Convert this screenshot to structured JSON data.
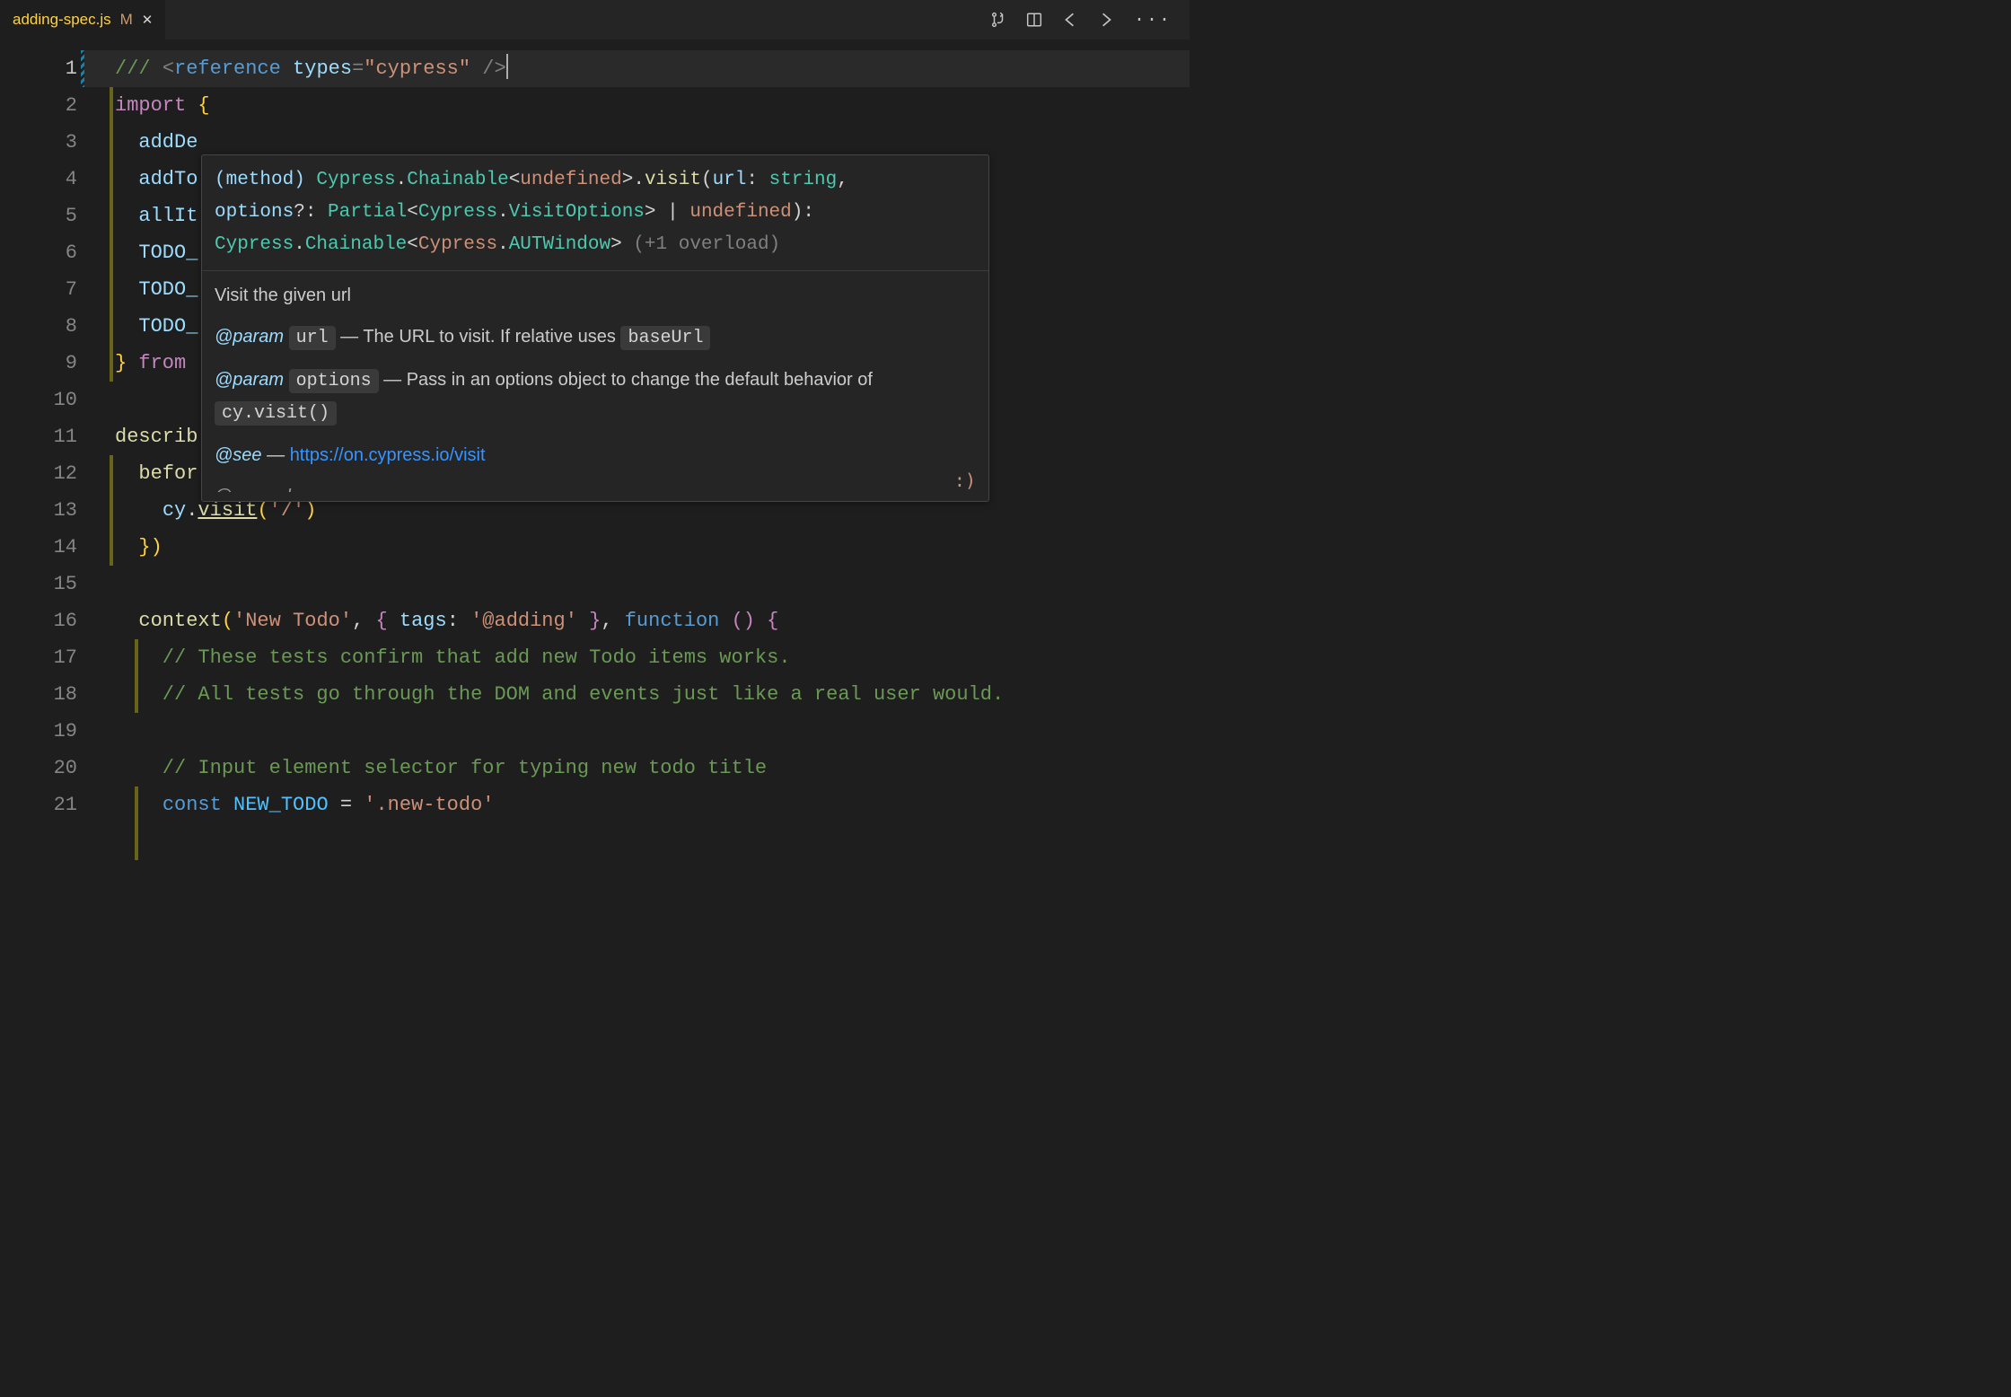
{
  "tab": {
    "filename": "adding-spec.js",
    "modified_marker": "M"
  },
  "line_numbers": [
    "1",
    "2",
    "3",
    "4",
    "5",
    "6",
    "7",
    "8",
    "9",
    "10",
    "11",
    "12",
    "13",
    "14",
    "15",
    "16",
    "17",
    "18",
    "19",
    "20",
    "21"
  ],
  "code": {
    "l1_ref": "/// <reference types=\"cypress\" />",
    "l2": "import {",
    "l3": "  addDe",
    "l4": "  addTo",
    "l5": "  allIt",
    "l6": "  TODO_",
    "l7": "  TODO_",
    "l8": "  TODO_",
    "l9": "} from ",
    "l11": "describ",
    "l12": "  befor",
    "l13_cy": "    cy.",
    "l13_visit": "visit",
    "l13_arg": "('/')",
    "l14": "  })",
    "l16_context": "  context(",
    "l16_str1": "'New Todo'",
    "l16_mid": ", { ",
    "l16_tags": "tags",
    "l16_colon": ": ",
    "l16_str2": "'@adding'",
    "l16_end": " }, ",
    "l16_func": "function",
    "l16_paren": " () {",
    "l17": "    // These tests confirm that add new Todo items works.",
    "l18": "    // All tests go through the DOM and events just like a real user would.",
    "l20": "    // Input element selector for typing new todo title",
    "l21_const": "    const ",
    "l21_name": "NEW_TODO",
    "l21_eq": " = ",
    "l21_val": "'.new-todo'"
  },
  "hover": {
    "sig_method": "(method)",
    "sig_cypress": " Cypress",
    "sig_dot": ".",
    "sig_chainable": "Chainable",
    "sig_lt": "<",
    "sig_undef": "undefined",
    "sig_gt_visit": ">.visit(",
    "sig_url": "url",
    "sig_colon_string": ": string, ",
    "sig_options": "options",
    "sig_opt_type": "?: Partial<Cypress.VisitOptions> | undefined): Cypress.Chainable<Cypress.AUTWindow>",
    "sig_overload": " (+1 overload)",
    "doc_visit": "Visit the given url",
    "doc_param": "@param",
    "doc_url_code": "url",
    "doc_url_desc": " — The URL to visit. If relative uses ",
    "doc_baseurl": "baseUrl",
    "doc_options_code": "options",
    "doc_options_desc": " — Pass in an options object to change the default behavior of ",
    "doc_cyvisit": "cy.visit()",
    "doc_see": "@see",
    "doc_see_dash": " — ",
    "doc_link": "https://on.cypress.io/visit",
    "doc_trunc": "@example",
    "smiley": ":)"
  }
}
